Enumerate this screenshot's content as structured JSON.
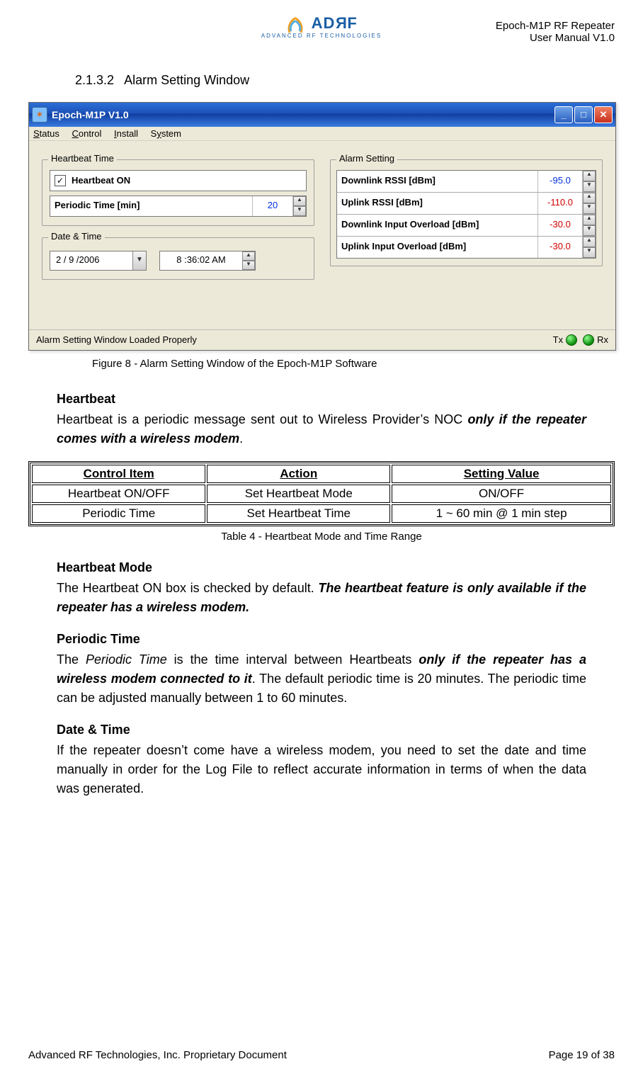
{
  "header": {
    "logo_text": "ADRF",
    "logo_sub": "ADVANCED RF TECHNOLOGIES",
    "line1": "Epoch-M1P RF Repeater",
    "line2": "User Manual V1.0"
  },
  "section": {
    "number": "2.1.3.2",
    "title": "Alarm Setting Window"
  },
  "window": {
    "title": "Epoch-M1P V1.0",
    "menu": {
      "m1": "Status",
      "m2": "Control",
      "m3": "Install",
      "m4": "System"
    },
    "heartbeat": {
      "legend": "Heartbeat Time",
      "check_label": "Heartbeat ON",
      "periodic_label": "Periodic Time [min]",
      "periodic_value": "20"
    },
    "datetime": {
      "legend": "Date & Time",
      "date": "2 / 9 /2006",
      "time": "8 :36:02 AM"
    },
    "alarm": {
      "legend": "Alarm Setting",
      "rows": [
        {
          "label": "Downlink RSSI  [dBm]",
          "val": "-95.0",
          "cls": "blue"
        },
        {
          "label": "Uplink RSSI  [dBm]",
          "val": "-110.0",
          "cls": "red"
        },
        {
          "label": "Downlink Input Overload [dBm]",
          "val": "-30.0",
          "cls": "red"
        },
        {
          "label": "Uplink Input Overload [dBm]",
          "val": "-30.0",
          "cls": "red"
        }
      ]
    },
    "status": {
      "msg": "Alarm Setting Window Loaded Properly",
      "tx": "Tx",
      "rx": "Rx"
    }
  },
  "fig8": "Figure 8 - Alarm Setting Window of the Epoch-M1P Software",
  "hb_section": {
    "title": "Heartbeat",
    "p1a": "Heartbeat is a periodic message sent out to Wireless Provider’s NOC ",
    "p1b": "only if the repeater comes with a wireless modem",
    "p1c": "."
  },
  "table4": {
    "h1": "Control Item",
    "h2": "Action",
    "h3": "Setting Value",
    "r1c1": "Heartbeat ON/OFF",
    "r1c2": "Set Heartbeat Mode",
    "r1c3": "ON/OFF",
    "r2c1": "Periodic Time",
    "r2c2": "Set Heartbeat Time",
    "r2c3": "1 ~ 60 min @ 1 min step",
    "caption": "Table 4 - Heartbeat Mode and Time Range"
  },
  "hbmode": {
    "title": "Heartbeat Mode",
    "p1a": "The Heartbeat ON box is checked by default.   ",
    "p1b": "The heartbeat feature is only available if the repeater has a wireless modem."
  },
  "pt": {
    "title": "Periodic Time",
    "a": "The ",
    "b": "Periodic Time",
    "c": " is the time interval between Heartbeats ",
    "d": "only if the repeater has a wireless modem connected to it",
    "e": ".  The default periodic time is 20 minutes.  The periodic time can be adjusted manually between 1 to 60 minutes."
  },
  "dt": {
    "title": "Date & Time",
    "p": "If the repeater doesn’t come have a wireless modem, you need to set the date and time manually in order for the Log File to reflect accurate information in terms of when the data was generated."
  },
  "footer": {
    "left": "Advanced RF Technologies, Inc. Proprietary Document",
    "right": "Page 19 of 38"
  }
}
